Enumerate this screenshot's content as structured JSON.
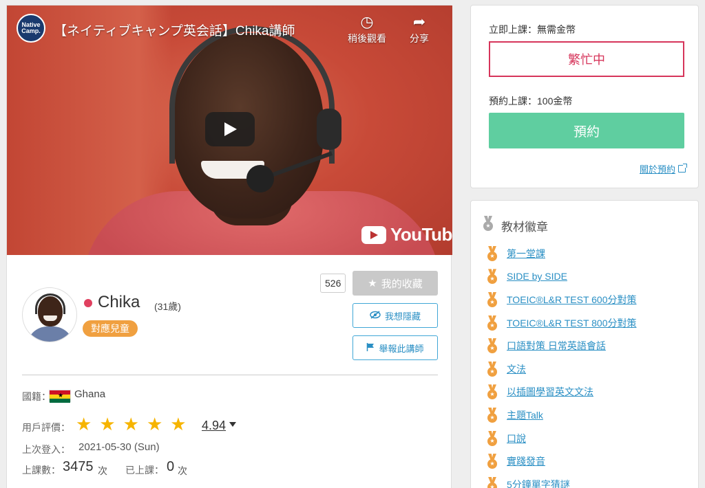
{
  "video": {
    "channel_logo": "Native Camp.",
    "title": "【ネイティブキャンプ英会話】Chika講師",
    "watch_later": "稍後觀看",
    "share": "分享",
    "youtube": "YouTube"
  },
  "profile": {
    "favorite_count": "526",
    "favorite_label": "我的收藏",
    "hide_label": "我想隱藏",
    "report_label": "舉報此講師",
    "name": "Chika",
    "age": "(31歲)",
    "kids_badge": "對應兒童",
    "nationality_label": "國籍：",
    "nationality": "Ghana",
    "rating_label": "用戶評價：",
    "rating_value": "4.94",
    "rating_stars": 5,
    "last_login_label": "上次登入：",
    "last_login": "2021-05-30 (Sun)",
    "lessons_label": "上課數：",
    "lessons_count": "3475",
    "lessons_unit": "次",
    "taken_label": "已上課：",
    "taken_count": "0",
    "taken_unit": "次"
  },
  "booking": {
    "now_label": "立即上課：無需金幣",
    "busy_label": "繁忙中",
    "reserve_label": "預約上課：100金幣",
    "reserve_button": "預約",
    "about_link": "關於預約"
  },
  "badges": {
    "title": "教材徽章",
    "items": [
      "第一堂課",
      "SIDE by SIDE",
      "TOEIC®L&R TEST 600分對策",
      "TOEIC®L&R TEST 800分對策",
      "口語對策 日常英語會話",
      "文法",
      "以插圖學習英文文法",
      "主題Talk",
      "口說",
      "實踐發音",
      "5分鐘單字猜謎"
    ]
  },
  "colors": {
    "busy": "#d6345a",
    "reserve": "#5fcea0",
    "link": "#2a8fc4",
    "kids_badge": "#f0a040",
    "star": "#f6b400",
    "online_dot": "#e0405f"
  }
}
